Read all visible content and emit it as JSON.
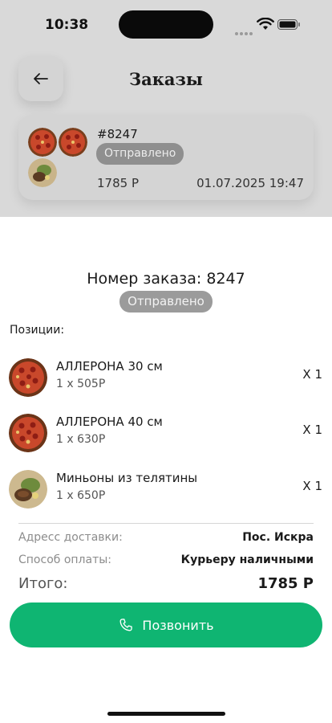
{
  "status_bar": {
    "time": "10:38"
  },
  "header": {
    "title": "Заказы",
    "back_icon": "arrow-left-icon"
  },
  "order_card": {
    "number": "#8247",
    "status": "Отправлено",
    "price": "1785 Р",
    "date": "01.07.2025 19:47"
  },
  "sheet": {
    "title": "Номер заказа: 8247",
    "status": "Отправлено",
    "positions_label": "Позиции:",
    "items": [
      {
        "name": "АЛЛЕРОНА 30 см",
        "price": "1 x 505P",
        "qty": "X 1",
        "image": "pizza"
      },
      {
        "name": "АЛЛЕРОНА 40 см",
        "price": "1 x 630P",
        "qty": "X 1",
        "image": "pizza"
      },
      {
        "name": "Миньоны из телятины",
        "price": "1 x 650P",
        "qty": "X 1",
        "image": "meat"
      }
    ],
    "delivery_label": "Адресс доставки:",
    "delivery_value": "Пос. Искра",
    "payment_label": "Способ оплаты:",
    "payment_value": "Курьеру наличными",
    "total_label": "Итого:",
    "total_value": "1785 Р",
    "call_button": "Позвонить"
  },
  "colors": {
    "accent": "#0fb572",
    "backdrop": "#d9d9d9",
    "badge": "#9b9b9b"
  }
}
